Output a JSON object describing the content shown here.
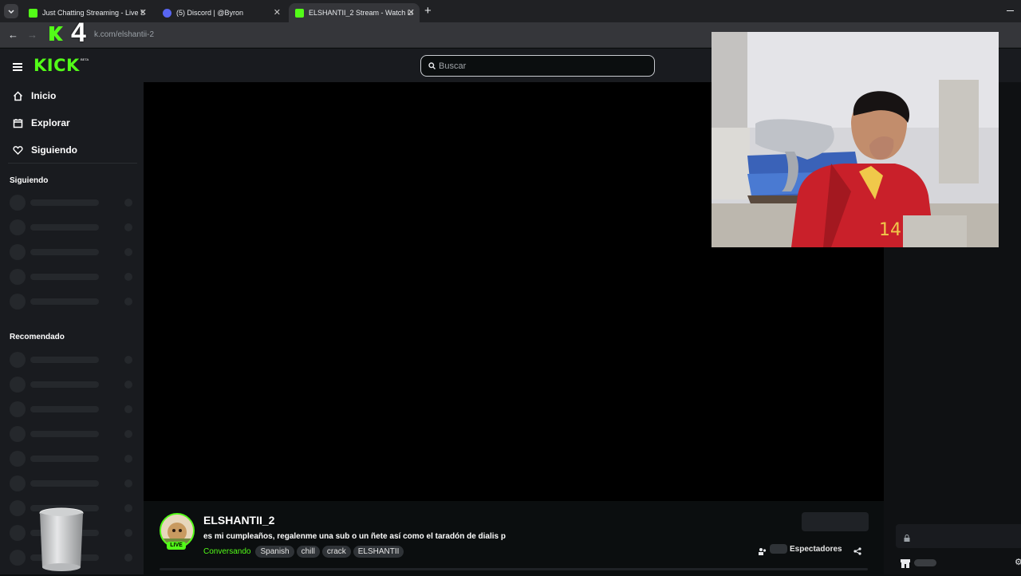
{
  "browser": {
    "tabs": [
      {
        "title": "Just Chatting Streaming - Live S",
        "favicon": "kick-icon",
        "active": false
      },
      {
        "title": "(5) Discord | @Byron",
        "favicon": "discord-icon",
        "active": false
      },
      {
        "title": "ELSHANTII_2 Stream - Watch Li",
        "favicon": "kick-icon",
        "active": true
      }
    ],
    "address": "k.com/elshantii-2"
  },
  "overlay": {
    "number": "4"
  },
  "header": {
    "logo": "KICK",
    "logo_badge": "BETA",
    "search_placeholder": "Buscar"
  },
  "sidebar": {
    "nav": [
      {
        "label": "Inicio",
        "icon": "home-icon"
      },
      {
        "label": "Explorar",
        "icon": "compass-icon"
      },
      {
        "label": "Siguiendo",
        "icon": "heart-icon"
      }
    ],
    "following_title": "Siguiendo",
    "recommended_title": "Recomendado"
  },
  "stream": {
    "channel": "ELSHANTII_2",
    "title": "es mi cumpleaños, regalenme una sub o un ñete así como el taradón de dialis p",
    "category": "Conversando",
    "tags": [
      "Spanish",
      "chill",
      "crack",
      "ELSHANTII"
    ],
    "live_badge": "LIVE",
    "viewers_label": "Espectadores"
  },
  "colors": {
    "kick_green": "#53fc18",
    "bg": "#0b0e0f",
    "panel": "#191b1f"
  }
}
